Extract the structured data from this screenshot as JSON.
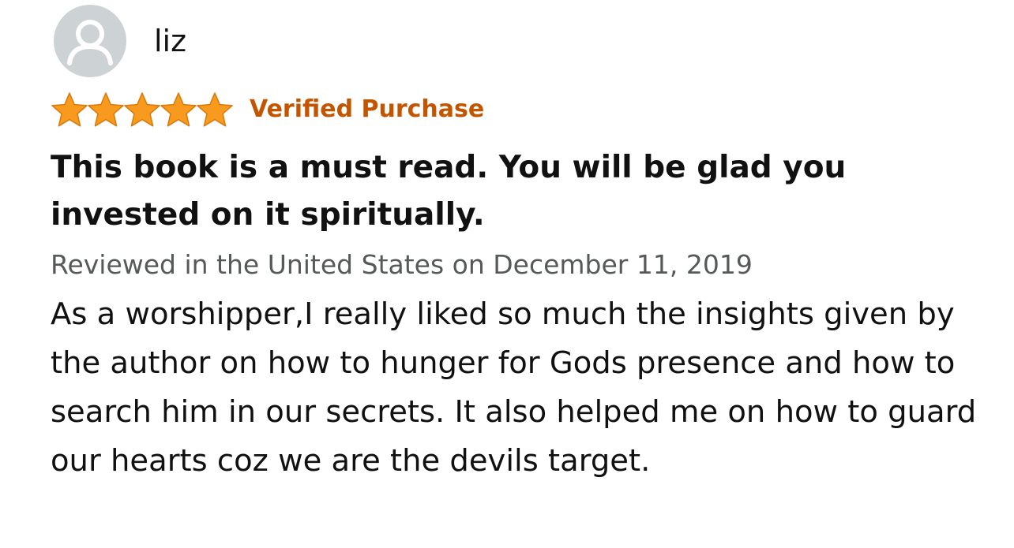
{
  "review": {
    "avatar_icon": "default-user-avatar-icon",
    "username": "liz",
    "rating": {
      "stars": 5,
      "max": 5,
      "color": "#f79a1d"
    },
    "verified_label": "Verified Purchase",
    "verified_color": "#c45500",
    "title": "This book is a must read. You will be glad you invested on it spiritually.",
    "meta": "Reviewed in the United States on December 11, 2019",
    "body": "As a worshipper,I really liked so much the insights given by the author on how to hunger for Gods presence and how to search him in our secrets. It also helped me on how to guard our hearts coz we are the devils target."
  }
}
